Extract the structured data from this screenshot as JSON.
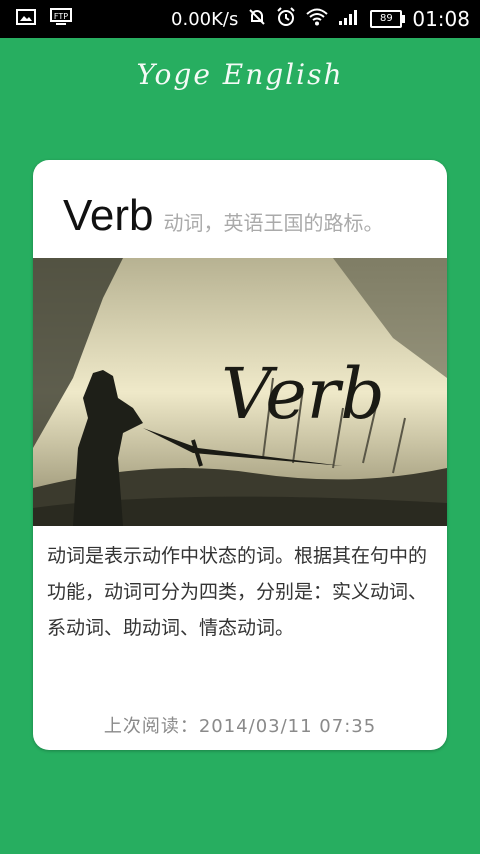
{
  "status_bar": {
    "net_speed": "0.00K/s",
    "battery": "89",
    "time": "01:08",
    "left_icons": [
      "image-icon",
      "ftp-icon"
    ],
    "right_icons": [
      "mute-icon",
      "alarm-icon",
      "wifi-icon",
      "signal-icon"
    ]
  },
  "app": {
    "title": "Yoge English"
  },
  "card": {
    "word": "Verb",
    "subtitle": "动词，英语王国的路标。",
    "image_text": "Verb",
    "description": "动词是表示动作中状态的词。根据其在句中的功能，动词可分为四类，分别是：实义动词、系动词、助动词、情态动词。",
    "last_read": "上次阅读：2014/03/11  07:35"
  },
  "colors": {
    "background": "#27ae60",
    "card": "#ffffff",
    "statusbar": "#000000"
  }
}
